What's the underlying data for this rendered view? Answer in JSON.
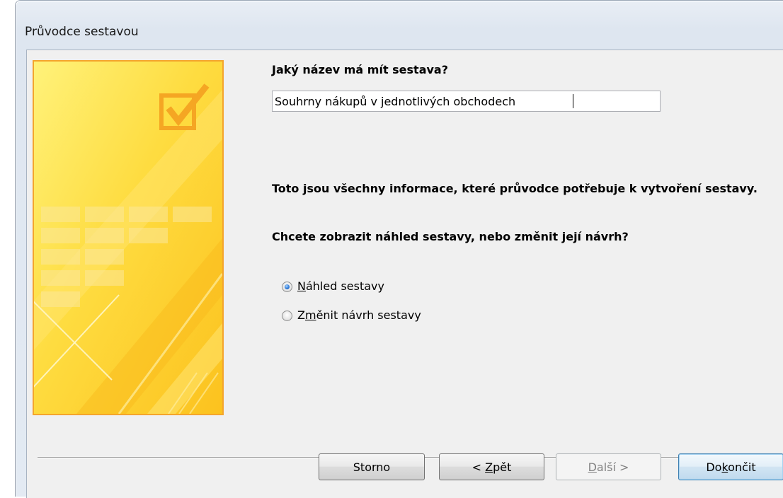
{
  "window": {
    "title": "Průvodce sestavou"
  },
  "wizard": {
    "name_question": "Jaký název má mít sestava?",
    "report_name_value": "Souhrny nákupů v jednotlivých obchodech",
    "info_text": "Toto jsou všechny informace, které průvodce potřebuje k vytvoření sestavy.",
    "choice_question": "Chcete zobrazit náhled sestavy, nebo změnit její návrh?",
    "options": [
      {
        "mnemonic": "N",
        "rest": "áhled sestavy",
        "selected": true
      },
      {
        "before": "Z",
        "mnemonic": "m",
        "rest": "ěnit návrh sestavy",
        "selected": false
      }
    ]
  },
  "buttons": {
    "cancel": "Storno",
    "back_prefix": "< ",
    "back_mnemonic": "Z",
    "back_rest": "pět",
    "next_mnemonic": "D",
    "next_rest": "alší >",
    "finish_before": "Do",
    "finish_mnemonic": "k",
    "finish_rest": "ončit"
  },
  "colors": {
    "image_border": "#f4a52c",
    "image_yellow": "#fdd33a",
    "checkmark": "#f5a623"
  }
}
